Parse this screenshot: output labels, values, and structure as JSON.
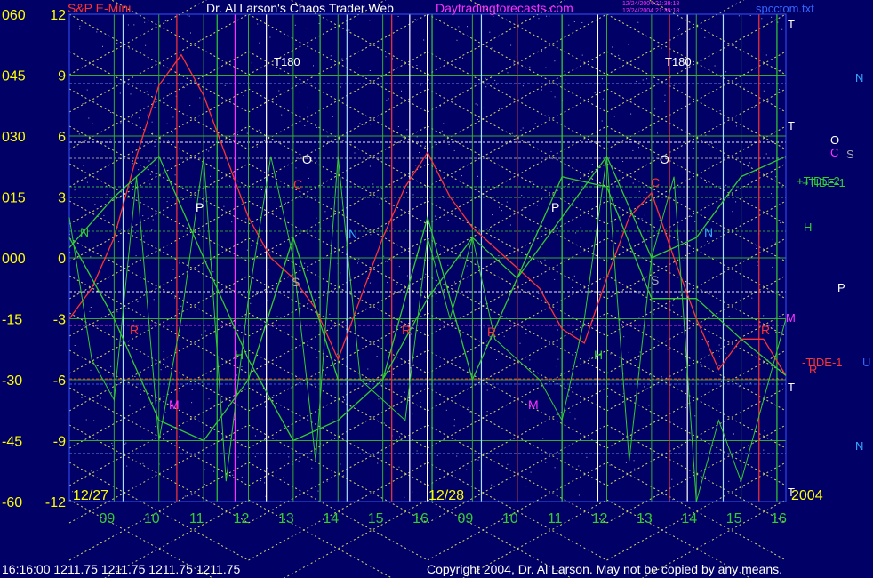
{
  "header": {
    "symbol": "S&P E-Mini",
    "author": "Dr. Al Larson's Chaos Trader Web",
    "site": "Daytradingforecasts.com",
    "stamp_line1": "12/24/2004 21:39:18",
    "stamp_line2": "12/24/2004 21:39:18",
    "filename": "spcctom.txt"
  },
  "chart_data": {
    "type": "line",
    "title": "S&P E-Mini",
    "y_left_ticks": [
      "060",
      "045",
      "030",
      "015",
      "000",
      "-15",
      "-30",
      "-45",
      "-60"
    ],
    "y_right_ticks": [
      "12",
      "9",
      "6",
      "3",
      "0",
      "-3",
      "-6",
      "-9",
      "-12"
    ],
    "ylim_outer": [
      -60,
      60
    ],
    "ylim_inner": [
      -12,
      12
    ],
    "x_day_labels": [
      "12/27",
      "12/28"
    ],
    "year_label": "2004",
    "x_hour_ticks": [
      "09",
      "10",
      "11",
      "12",
      "13",
      "14",
      "15",
      "16",
      "09",
      "10",
      "11",
      "12",
      "13",
      "14",
      "15",
      "16"
    ],
    "grid": true,
    "annotations": {
      "top_labels": [
        "T180",
        "T180"
      ],
      "right_t_labels": [
        "T",
        "T",
        "T",
        "T"
      ],
      "right_side": [
        {
          "text": "N",
          "color": "#33aaff"
        },
        {
          "text": "O",
          "color": "#ffffff"
        },
        {
          "text": "C",
          "color": "#ff33ff"
        },
        {
          "text": "S",
          "color": "#aaaaaa"
        },
        {
          "text": "+TIDE-2",
          "color": "#33cc33"
        },
        {
          "text": "+TIDE-1",
          "color": "#33cc33"
        },
        {
          "text": "H",
          "color": "#33cc33"
        },
        {
          "text": "P",
          "color": "#ffffff"
        },
        {
          "text": "M",
          "color": "#ff33ff"
        },
        {
          "text": "-TIDE-1",
          "color": "#ff3333"
        },
        {
          "text": "R",
          "color": "#ff3333"
        },
        {
          "text": "U",
          "color": "#3366ff"
        },
        {
          "text": "N",
          "color": "#33aaff"
        }
      ],
      "plot_letters": [
        {
          "text": "N",
          "color": "#33cc33"
        },
        {
          "text": "P",
          "color": "#ffffff"
        },
        {
          "text": "O",
          "color": "#ffffff"
        },
        {
          "text": "C",
          "color": "#ff3333"
        },
        {
          "text": "N",
          "color": "#33aaff"
        },
        {
          "text": "S",
          "color": "#aaaaaa"
        },
        {
          "text": "R",
          "color": "#ff3333"
        },
        {
          "text": "H",
          "color": "#33cc33"
        },
        {
          "text": "M",
          "color": "#ff33ff"
        },
        {
          "text": "R",
          "color": "#ff3333"
        },
        {
          "text": "P",
          "color": "#ffffff"
        },
        {
          "text": "R",
          "color": "#ff3333"
        },
        {
          "text": "M",
          "color": "#ff33ff"
        },
        {
          "text": "H",
          "color": "#33cc33"
        },
        {
          "text": "O",
          "color": "#ffffff"
        },
        {
          "text": "C",
          "color": "#ff3333"
        },
        {
          "text": "S",
          "color": "#aaaaaa"
        },
        {
          "text": "N",
          "color": "#33aaff"
        },
        {
          "text": "R",
          "color": "#ff3333"
        }
      ]
    },
    "series": [
      {
        "color": "#ff3333",
        "x": [
          0,
          0.5,
          1,
          1.5,
          2,
          2.5,
          3,
          3.5,
          4,
          4.5,
          5,
          5.5,
          6,
          6.5,
          7,
          7.5,
          8,
          8.5,
          9,
          9.5,
          10,
          10.5,
          11,
          11.5,
          12,
          12.5,
          13,
          13.5,
          14,
          14.5,
          15,
          15.5,
          16
        ],
        "y": [
          -3,
          -1.5,
          1,
          5,
          8.5,
          10,
          8,
          5,
          2,
          0,
          -1,
          -2.5,
          -5,
          -2,
          1,
          3.5,
          5.2,
          3,
          1.5,
          0.5,
          -0.5,
          -1.5,
          -3.5,
          -4.2,
          -1,
          2,
          3.2,
          0,
          -3,
          -5.5,
          -4,
          -4,
          -5.8
        ]
      },
      {
        "color": "#33cc33",
        "x": [
          0,
          0.5,
          1,
          1.5,
          2,
          2.5,
          3,
          3.5,
          4,
          4.5,
          5,
          5.5,
          6,
          6.5,
          7,
          7.5,
          8,
          8.5,
          9,
          9.5,
          10,
          10.5,
          11,
          11.5,
          12,
          12.5,
          13,
          13.5,
          14,
          14.5,
          15,
          15.5,
          16
        ],
        "y": [
          2,
          -5,
          -7,
          4,
          -9,
          -3,
          5,
          -11,
          -2,
          5,
          0,
          -10,
          5,
          -6,
          -7,
          -8,
          1,
          -3,
          1,
          -4,
          -5,
          -6,
          -8,
          -3,
          5,
          -10,
          0,
          4,
          -12,
          -8,
          -11,
          -7,
          -3
        ]
      },
      {
        "color": "#33cc33",
        "x": [
          0,
          1,
          2,
          3,
          4,
          5,
          6,
          7,
          8,
          9,
          10,
          11,
          12,
          13,
          14,
          15,
          16
        ],
        "y": [
          1,
          -3,
          -8,
          -9,
          -6,
          1,
          -6,
          -6,
          2,
          -6,
          -1,
          4,
          3.5,
          -2,
          -2,
          -4,
          -5.8
        ]
      },
      {
        "color": "#33cc33",
        "x": [
          0,
          1,
          2,
          3,
          4,
          5,
          6,
          7,
          8,
          9,
          10,
          11,
          12,
          13,
          14,
          15,
          16
        ],
        "y": [
          0.5,
          3,
          5,
          0,
          -5,
          -9,
          -8,
          -6,
          -2,
          1,
          -1,
          2,
          5,
          0,
          1,
          4,
          5
        ]
      }
    ]
  },
  "footer": {
    "quote": "16:16:00  1211.75  1211.75  1211.75  1211.75",
    "copyright": "Copyright 2004, Dr. Al Larson. May not be copied by any means."
  }
}
